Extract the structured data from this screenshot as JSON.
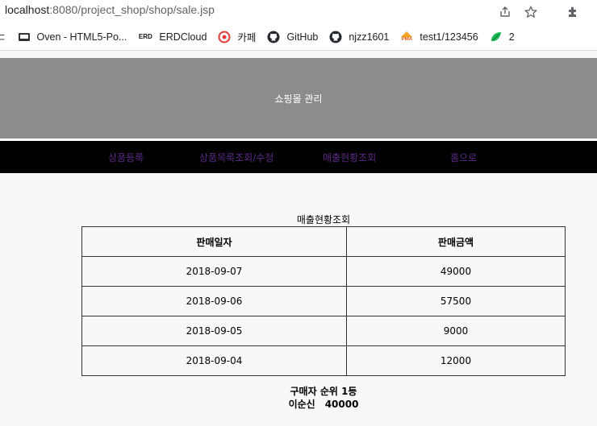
{
  "browser": {
    "url_host": "localhost",
    "url_path": ":8080/project_shop/shop/sale.jsp",
    "bookmarks": [
      {
        "label": "Oven - HTML5-Po...",
        "icon": "oven-icon"
      },
      {
        "label": "ERDCloud",
        "icon": "erd-icon",
        "icon_text": "ERD"
      },
      {
        "label": "카페",
        "icon": "cafe-icon"
      },
      {
        "label": "GitHub",
        "icon": "github-icon"
      },
      {
        "label": "njzz1601",
        "icon": "github-icon"
      },
      {
        "label": "test1/123456",
        "icon": "pma-icon",
        "icon_text": "PMA"
      },
      {
        "label": "2",
        "icon": "green-leaf-icon"
      }
    ]
  },
  "header": {
    "title": "쇼핑몰 관리"
  },
  "nav": {
    "items": [
      "상품등록",
      "상품목록조회/수정",
      "매출현황조회",
      "홈으로"
    ],
    "link_color": "#5b2a86"
  },
  "sales": {
    "caption": "매출현황조회",
    "columns": [
      "판매일자",
      "판매금액"
    ],
    "rows": [
      [
        "2018-09-07",
        "49000"
      ],
      [
        "2018-09-06",
        "57500"
      ],
      [
        "2018-09-05",
        "9000"
      ],
      [
        "2018-09-04",
        "12000"
      ]
    ]
  },
  "rank": {
    "title": "구매자 순위 1등",
    "name": "이순신",
    "amount": "40000"
  },
  "colors": {
    "header_bg": "#8c8c8c",
    "nav_bg": "#000000",
    "page_bg": "#f8f8f8"
  }
}
